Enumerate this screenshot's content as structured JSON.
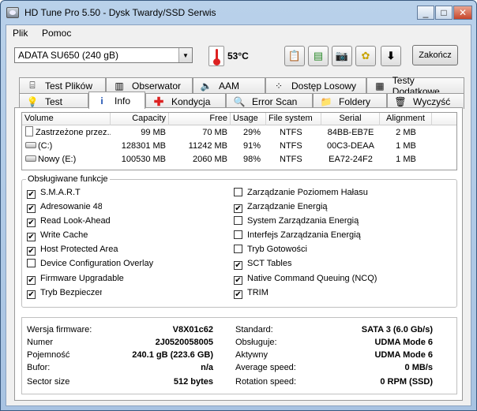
{
  "window": {
    "title": "HD Tune Pro 5.50 - Dysk Twardy/SSD Serwis",
    "controls": {
      "minimize": "_",
      "maximize": "□",
      "close": "✕"
    }
  },
  "menu": {
    "plik": "Plik",
    "pomoc": "Pomoc"
  },
  "toolbar": {
    "drive": "ADATA SU650 (240 gB)",
    "temperature": "53°C",
    "exit_label": "Zakończ",
    "icons": [
      "copy-icon",
      "save-icon",
      "camera-icon",
      "options-icon",
      "download-icon"
    ]
  },
  "tabs_top": [
    {
      "label": "Test Plików",
      "icon": "file-test-icon"
    },
    {
      "label": "Obserwator",
      "icon": "monitor-icon"
    },
    {
      "label": "AAM",
      "icon": "speaker-icon"
    },
    {
      "label": "Dostęp Losowy",
      "icon": "random-access-icon"
    },
    {
      "label": "Testy Dodatkowe",
      "icon": "extra-tests-icon"
    }
  ],
  "tabs_bottom": [
    {
      "label": "Test",
      "icon": "benchmark-icon"
    },
    {
      "label": "Info",
      "icon": "info-icon"
    },
    {
      "label": "Kondycja",
      "icon": "health-icon"
    },
    {
      "label": "Error Scan",
      "icon": "magnifier-icon"
    },
    {
      "label": "Foldery",
      "icon": "folder-icon"
    },
    {
      "label": "Wyczyść",
      "icon": "trash-icon"
    }
  ],
  "active_tab": "Info",
  "partitions": {
    "headers": [
      "Volume",
      "Capacity",
      "Free",
      "Usage",
      "File system",
      "Serial",
      "Alignment"
    ],
    "rows": [
      {
        "volume": "Zastrzeżone przez...",
        "capacity": "99 MB",
        "free": "70 MB",
        "usage": "29%",
        "fs": "NTFS",
        "serial": "84BB-EB7E",
        "alignment": "2 MB",
        "icon": "file-icon"
      },
      {
        "volume": "(C:)",
        "capacity": "128301 MB",
        "free": "11242 MB",
        "usage": "91%",
        "fs": "NTFS",
        "serial": "00C3-DEAA",
        "alignment": "1 MB",
        "icon": "drive-icon"
      },
      {
        "volume": "Nowy (E:)",
        "capacity": "100530 MB",
        "free": "2060 MB",
        "usage": "98%",
        "fs": "NTFS",
        "serial": "EA72-24F2",
        "alignment": "1 MB",
        "icon": "drive-icon"
      }
    ]
  },
  "features": {
    "title": "Obsługiwane funkcje",
    "left": [
      {
        "label": "S.M.A.R.T",
        "checked": true
      },
      {
        "label": "Adresowanie 48",
        "checked": true
      },
      {
        "label": "Read Look-Ahead",
        "checked": true
      },
      {
        "label": "Write Cache",
        "checked": true
      },
      {
        "label": "Host Protected Area",
        "checked": true
      },
      {
        "label": "Device Configuration Overlay",
        "checked": false
      },
      {
        "label": "Firmware Upgradable",
        "checked": true
      },
      {
        "label": "Tryb Bezpieczeństwa",
        "checked": true
      }
    ],
    "right": [
      {
        "label": "Zarządzanie Poziomem Hałasu",
        "checked": false
      },
      {
        "label": "Zarządzanie Energią",
        "checked": true
      },
      {
        "label": "System Zarządzania Energią",
        "checked": false
      },
      {
        "label": "Interfejs Zarządzania Energią",
        "checked": false
      },
      {
        "label": "Tryb Gotowości",
        "checked": false
      },
      {
        "label": "SCT Tables",
        "checked": true
      },
      {
        "label": "Native Command Queuing (NCQ)",
        "checked": true
      },
      {
        "label": "TRIM",
        "checked": true
      }
    ]
  },
  "details": {
    "left": [
      {
        "label": "Wersja firmware:",
        "value": "V8X01c62"
      },
      {
        "label": "Numer",
        "value": "2J0520058005"
      },
      {
        "label": "Pojemność",
        "value": "240.1 gB (223.6 GB)"
      },
      {
        "label": "Bufor:",
        "value": "n/a"
      },
      {
        "label": "Sector size",
        "value": "512 bytes"
      }
    ],
    "right": [
      {
        "label": "Standard:",
        "value": "SATA 3 (6.0 Gb/s)"
      },
      {
        "label": "Obsługuje:",
        "value": "UDMA Mode 6"
      },
      {
        "label": "Aktywny",
        "value": "UDMA Mode 6"
      },
      {
        "label": "Average speed:",
        "value": "0 MB/s"
      },
      {
        "label": "Rotation speed:",
        "value": "0 RPM (SSD)"
      }
    ]
  }
}
